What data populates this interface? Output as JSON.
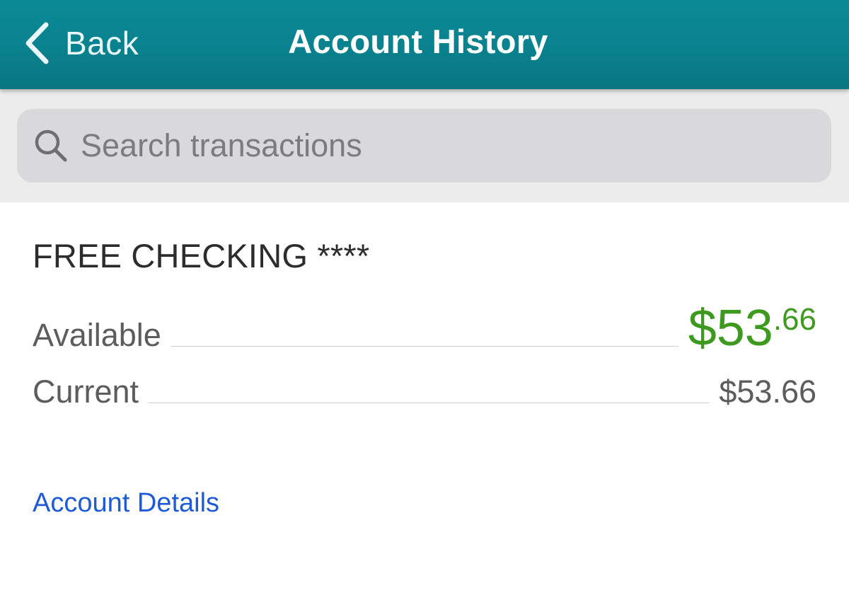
{
  "nav": {
    "back_label": "Back",
    "title": "Account History"
  },
  "search": {
    "placeholder": "Search transactions",
    "value": ""
  },
  "account": {
    "name": "FREE CHECKING ****",
    "available_label": "Available",
    "available_dollars": "$53",
    "available_cents": ".66",
    "current_label": "Current",
    "current_amount": "$53.66",
    "details_link": "Account Details"
  },
  "colors": {
    "header": "#0a818e",
    "available_amount": "#3d9a1f",
    "link": "#1f5bd6"
  },
  "icons": {
    "back": "chevron-left-icon",
    "search": "search-icon"
  }
}
